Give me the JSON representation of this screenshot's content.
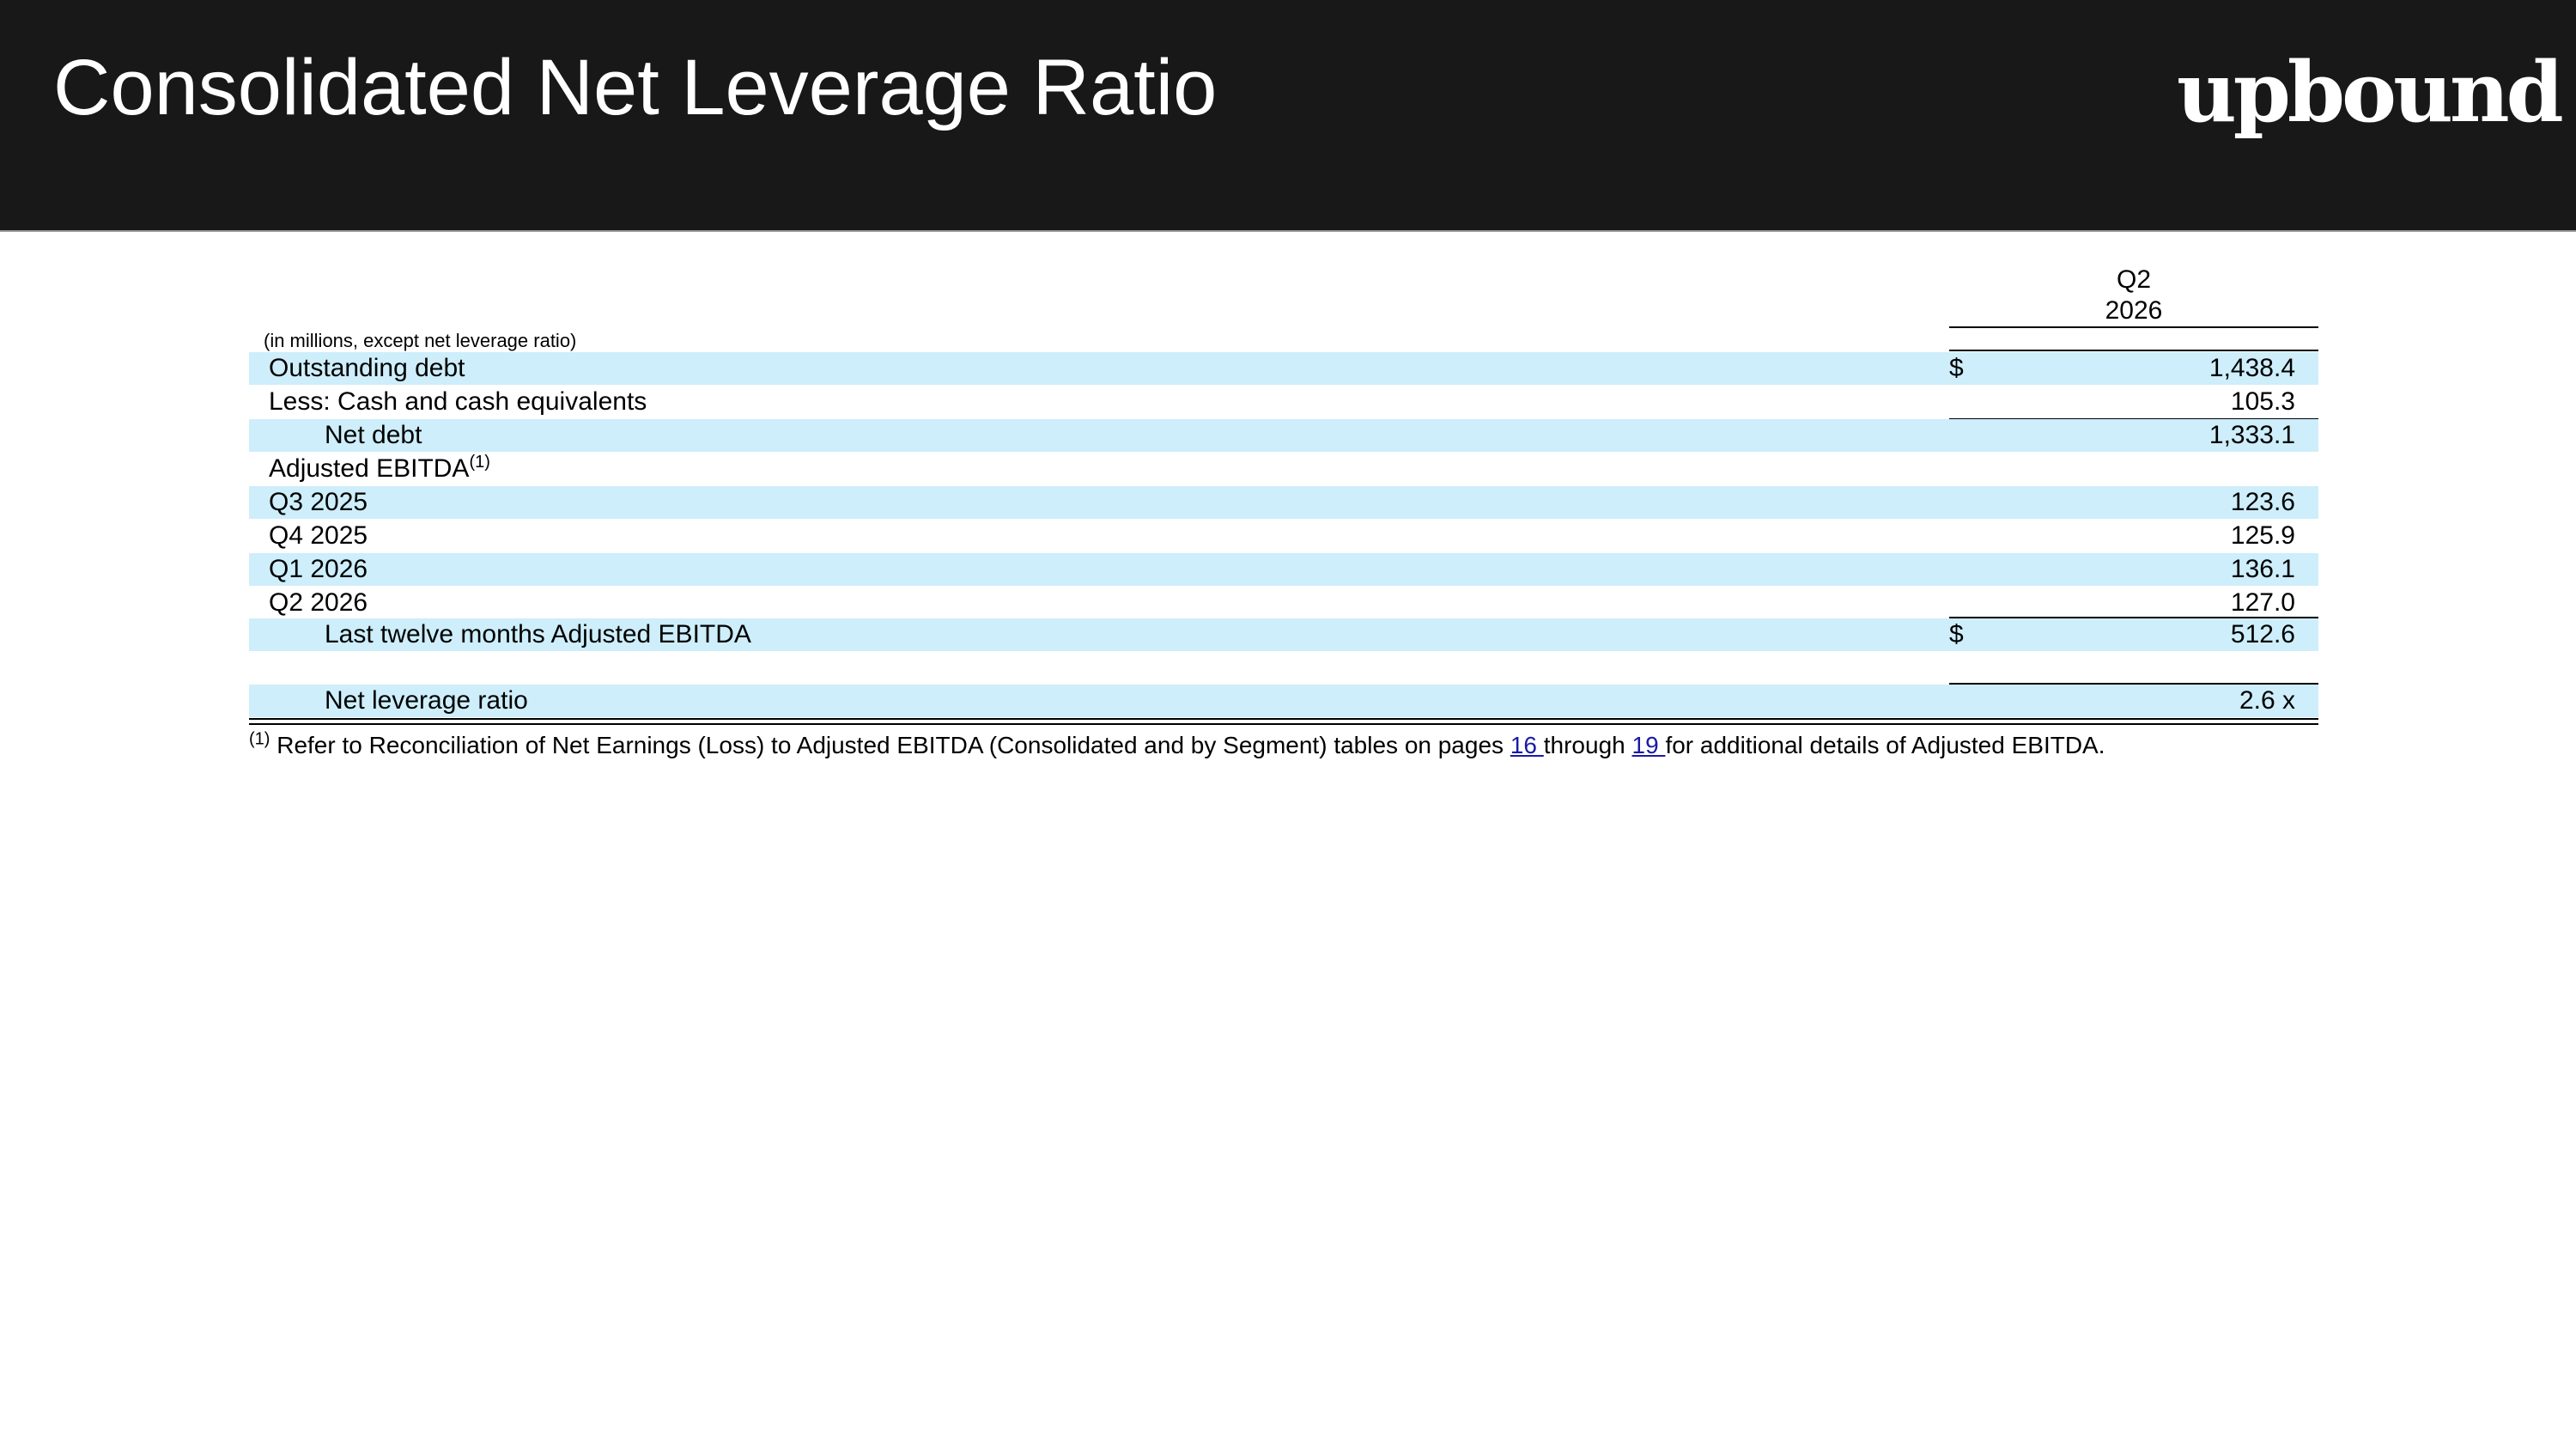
{
  "header": {
    "title": "Consolidated Net Leverage Ratio",
    "logo_text": "upbound",
    "background": "#181818"
  },
  "table": {
    "column_header_line1": "Q2",
    "column_header_line2": "2026",
    "units_note": "(in millions, except net leverage ratio)",
    "row_shading": "#cdeefa",
    "rows": [
      {
        "label": "Outstanding debt",
        "dollar": "$",
        "value": "1,438.4"
      },
      {
        "label": "Less: Cash and cash equivalents",
        "dollar": "",
        "value": "105.3"
      },
      {
        "label": "Net debt",
        "dollar": "",
        "value": "1,333.1"
      },
      {
        "label": "Adjusted EBITDA",
        "sup": "(1)",
        "dollar": "",
        "value": ""
      },
      {
        "label": "Q3 2025",
        "dollar": "",
        "value": "123.6"
      },
      {
        "label": "Q4 2025",
        "dollar": "",
        "value": "125.9"
      },
      {
        "label": "Q1 2026",
        "dollar": "",
        "value": "136.1"
      },
      {
        "label": "Q2 2026",
        "dollar": "",
        "value": "127.0"
      },
      {
        "label": "Last twelve months Adjusted EBITDA",
        "dollar": "$",
        "value": "512.6"
      },
      {
        "label": "Net leverage ratio",
        "dollar": "",
        "value": "2.6 x"
      }
    ]
  },
  "footnote": {
    "marker": "(1)",
    "text_before": "Refer to Reconciliation of Net Earnings (Loss) to Adjusted EBITDA (Consolidated and by Segment) tables on pages ",
    "link1": "16 ",
    "text_middle": "through ",
    "link2": "19 ",
    "text_after": "for additional details of Adjusted EBITDA."
  }
}
